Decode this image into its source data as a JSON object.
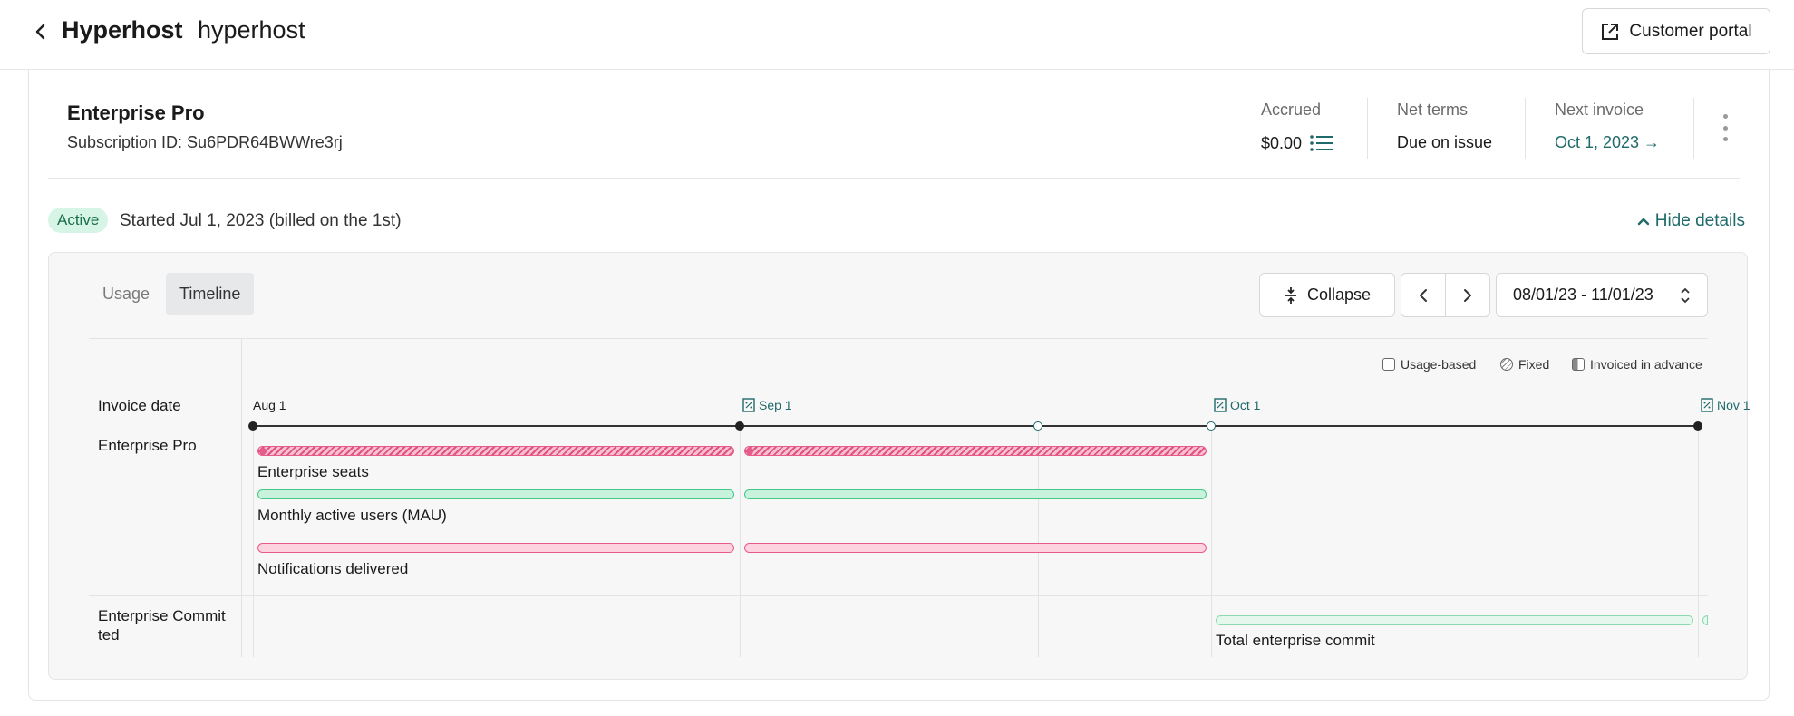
{
  "header": {
    "title": "Hyperhost",
    "subtitle": "hyperhost",
    "portal_label": "Customer portal"
  },
  "subscription": {
    "plan_name": "Enterprise Pro",
    "subscription_id": "Subscription ID: Su6PDR64BWWre3rj",
    "accrued_label": "Accrued",
    "accrued_value": "$0.00",
    "net_terms_label": "Net terms",
    "net_terms_value": "Due on issue",
    "next_invoice_label": "Next invoice",
    "next_invoice_value": "Oct 1, 2023 →"
  },
  "status": {
    "badge": "Active",
    "started": "Started Jul 1, 2023 (billed on the 1st)",
    "toggle_label": "Hide details"
  },
  "tabs": [
    {
      "label": "Usage",
      "active": false
    },
    {
      "label": "Timeline",
      "active": true
    }
  ],
  "toolbar": {
    "collapse_label": "Collapse",
    "date_range": "08/01/23 - 11/01/23"
  },
  "legend": {
    "usage_based": "Usage-based",
    "fixed": "Fixed",
    "advance": "Invoiced in advance"
  },
  "timeline": {
    "row_labels": {
      "invoice_date": "Invoice date",
      "enterprise_pro": "Enterprise Pro",
      "enterprise_committed": "Enterprise Commit ted"
    },
    "dates": [
      "Aug 1",
      "Sep 1",
      "Oct 1",
      "Nov 1"
    ],
    "items": {
      "seats": "Enterprise seats",
      "mau": "Monthly active users (MAU)",
      "notifications": "Notifications delivered",
      "commit": "Total enterprise commit"
    }
  },
  "colors": {
    "accent": "#1f6a6a",
    "active_badge_bg": "#d6f5e6",
    "fixed_bar": "#e65b8a",
    "usage_bar": "#43c987"
  }
}
